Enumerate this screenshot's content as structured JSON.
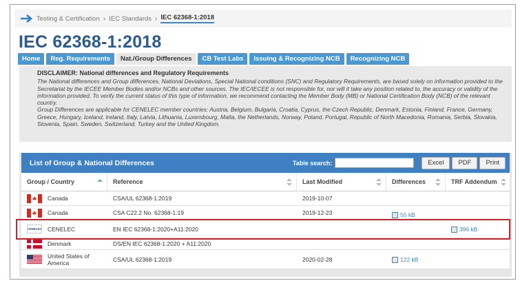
{
  "breadcrumb": {
    "items": [
      "Testing & Certification",
      "IEC Standards"
    ],
    "current": "IEC 62368-1:2018"
  },
  "page": {
    "title": "IEC 62368-1:2018"
  },
  "tabs": [
    {
      "label": "Home",
      "active": false
    },
    {
      "label": "Reg. Requirements",
      "active": false
    },
    {
      "label": "Nat./Group Differences",
      "active": true
    },
    {
      "label": "CB Test Labs",
      "active": false
    },
    {
      "label": "Issuing & Recognizing NCB",
      "active": false
    },
    {
      "label": "Recognizing NCB",
      "active": false
    }
  ],
  "disclaimer": {
    "title": "DISCLAIMER: National differences and Regulatory Requirements",
    "para1": "The National differences and Group differences, National Deviations, Special National conditions (SNC) and Regulatory Requirements, are based solely on information provided to the Secretariat by the IECEE Member Bodies and/or NCBs and other sources. The IEC/IECEE is not responsible for, nor will it take any position related to, the accuracy or validity of the information provided. To verify the current status of this type of information, we recommend contacting the Member Body (MB) or National Certification Body (NCB) of the relevant country.",
    "para2": "Group Differences are applicable for CENELEC member countries: Austria, Belgium, Bulgaria, Croatia, Cyprus, the Czech Republic, Denmark, Estonia, Finland, France, Germany, Greece, Hungary, Iceland, Ireland, Italy, Latvia, Lithuania, Luxembourg, Malta, the Netherlands, Norway, Poland, Portugal, Republic of North Macedonia, Romania, Serbia, Slovakia, Slovenia, Spain, Sweden, Switzerland, Turkey and the United Kingdom."
  },
  "table": {
    "title": "List of Group & National Differences",
    "search_label": "Table search:",
    "search_value": "",
    "buttons": {
      "excel": "Excel",
      "pdf": "PDF",
      "print": "Print"
    },
    "columns": {
      "country": "Group / Country",
      "reference": "Reference",
      "modified": "Last Modified",
      "differences": "Differences",
      "trf": "TRF Addendum"
    },
    "rows": [
      {
        "country": "Canada",
        "flag": "canada",
        "reference": "CSA/UL 62368-1:2019",
        "modified": "2019-10-07",
        "differences": "",
        "trf": ""
      },
      {
        "country": "Canada",
        "flag": "canada",
        "reference": "CSA C22.2 No. 62368-1:19",
        "modified": "2019-12-23",
        "differences": "55 kB",
        "trf": ""
      },
      {
        "country": "CENELEC",
        "flag": "cenelec",
        "flag_text": "CENELEC",
        "reference": "EN IEC 62368-1:2020+A11:2020",
        "modified": "",
        "differences": "",
        "trf": "396 kB"
      },
      {
        "country": "Denmark",
        "flag": "denmark",
        "reference": "DS/EN IEC 62368-1:2020 + A11:2020",
        "modified": "",
        "differences": "",
        "trf": ""
      },
      {
        "country": "United States of America",
        "flag": "usa",
        "reference": "CSA/UL 62368-1:2019",
        "modified": "2020-02-28",
        "differences": "122 kB",
        "trf": ""
      }
    ]
  },
  "colors": {
    "accent": "#3f80c2",
    "title": "#2d5a8e",
    "highlight": "#d0202a"
  }
}
